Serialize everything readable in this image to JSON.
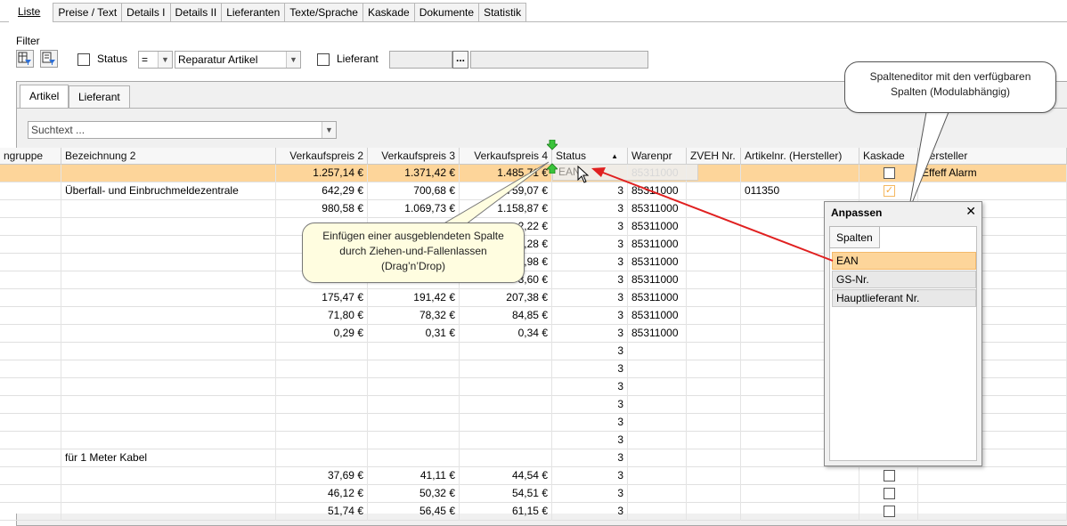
{
  "top_tabs": [
    "Liste",
    "Preise / Text",
    "Details I",
    "Details II",
    "Lieferanten",
    "Texte/Sprache",
    "Kaskade",
    "Dokumente",
    "Statistik"
  ],
  "filter": {
    "label": "Filter",
    "status_label": "Status",
    "operator": "=",
    "status_value": "Reparatur Artikel",
    "lieferant_label": "Lieferant",
    "lieferant_button": "..."
  },
  "inner_tabs": [
    "Artikel",
    "Lieferant"
  ],
  "search_placeholder": "Suchtext ...",
  "columns": [
    "ngruppe",
    "Bezeichnung 2",
    "Verkaufspreis 2",
    "Verkaufspreis 3",
    "Verkaufspreis 4",
    "Status",
    "Warenpr",
    "ZVEH Nr.",
    "Artikelnr. (Hersteller)",
    "Kaskade",
    "Hersteller"
  ],
  "sort_icon": "sort-ascending-icon",
  "rows": [
    {
      "bez": "",
      "vk2": "1.257,14 €",
      "vk3": "1.371,42 €",
      "vk4": "1.485,71 €",
      "status": "",
      "waren": "85311000",
      "zveh": "",
      "artnr": "",
      "kaskade": "unchecked",
      "hersteller": "Effeff Alarm"
    },
    {
      "bez": "Überfall- und Einbruchmeldezentrale",
      "vk2": "642,29 €",
      "vk3": "700,68 €",
      "vk4": "759,07 €",
      "status": "3",
      "waren": "85311000",
      "zveh": "",
      "artnr": "011350",
      "kaskade": "checked",
      "hersteller": ""
    },
    {
      "bez": "",
      "vk2": "980,58 €",
      "vk3": "1.069,73 €",
      "vk4": "1.158,87 €",
      "status": "3",
      "waren": "85311000",
      "zveh": "",
      "artnr": "",
      "kaskade": "",
      "hersteller": ""
    },
    {
      "bez": "",
      "vk2": "",
      "vk3": "",
      "vk4": "2,22 €",
      "status": "3",
      "waren": "85311000",
      "zveh": "",
      "artnr": "",
      "kaskade": "",
      "hersteller": ""
    },
    {
      "bez": "",
      "vk2": "",
      "vk3": "",
      "vk4": "8,28 €",
      "status": "3",
      "waren": "85311000",
      "zveh": "",
      "artnr": "",
      "kaskade": "",
      "hersteller": ""
    },
    {
      "bez": "",
      "vk2": "",
      "vk3": "",
      "vk4": "5,98 €",
      "status": "3",
      "waren": "85311000",
      "zveh": "",
      "artnr": "",
      "kaskade": "",
      "hersteller": ""
    },
    {
      "bez": "",
      "vk2": "",
      "vk3": "",
      "vk4": "3,60 €",
      "status": "3",
      "waren": "85311000",
      "zveh": "",
      "artnr": "",
      "kaskade": "",
      "hersteller": ""
    },
    {
      "bez": "",
      "vk2": "175,47 €",
      "vk3": "191,42 €",
      "vk4": "207,38 €",
      "status": "3",
      "waren": "85311000",
      "zveh": "",
      "artnr": "",
      "kaskade": "",
      "hersteller": ""
    },
    {
      "bez": "",
      "vk2": "71,80 €",
      "vk3": "78,32 €",
      "vk4": "84,85 €",
      "status": "3",
      "waren": "85311000",
      "zveh": "",
      "artnr": "",
      "kaskade": "",
      "hersteller": ""
    },
    {
      "bez": "",
      "vk2": "0,29 €",
      "vk3": "0,31 €",
      "vk4": "0,34 €",
      "status": "3",
      "waren": "85311000",
      "zveh": "",
      "artnr": "",
      "kaskade": "",
      "hersteller": ""
    },
    {
      "bez": "",
      "vk2": "",
      "vk3": "",
      "vk4": "",
      "status": "3",
      "waren": "",
      "zveh": "",
      "artnr": "",
      "kaskade": "",
      "hersteller": ""
    },
    {
      "bez": "",
      "vk2": "",
      "vk3": "",
      "vk4": "",
      "status": "3",
      "waren": "",
      "zveh": "",
      "artnr": "",
      "kaskade": "",
      "hersteller": ""
    },
    {
      "bez": "",
      "vk2": "",
      "vk3": "",
      "vk4": "",
      "status": "3",
      "waren": "",
      "zveh": "",
      "artnr": "",
      "kaskade": "",
      "hersteller": ""
    },
    {
      "bez": "",
      "vk2": "",
      "vk3": "",
      "vk4": "",
      "status": "3",
      "waren": "",
      "zveh": "",
      "artnr": "",
      "kaskade": "",
      "hersteller": ""
    },
    {
      "bez": "",
      "vk2": "",
      "vk3": "",
      "vk4": "",
      "status": "3",
      "waren": "",
      "zveh": "",
      "artnr": "",
      "kaskade": "",
      "hersteller": ""
    },
    {
      "bez": "",
      "vk2": "",
      "vk3": "",
      "vk4": "",
      "status": "3",
      "waren": "",
      "zveh": "",
      "artnr": "",
      "kaskade": "",
      "hersteller": ""
    },
    {
      "bez": "für 1 Meter Kabel",
      "vk2": "",
      "vk3": "",
      "vk4": "",
      "status": "3",
      "waren": "",
      "zveh": "",
      "artnr": "",
      "kaskade": "",
      "hersteller": ""
    },
    {
      "bez": "",
      "vk2": "37,69 €",
      "vk3": "41,11 €",
      "vk4": "44,54 €",
      "status": "3",
      "waren": "",
      "zveh": "",
      "artnr": "",
      "kaskade": "unchecked",
      "hersteller": ""
    },
    {
      "bez": "",
      "vk2": "46,12 €",
      "vk3": "50,32 €",
      "vk4": "54,51 €",
      "status": "3",
      "waren": "",
      "zveh": "",
      "artnr": "",
      "kaskade": "unchecked",
      "hersteller": ""
    },
    {
      "bez": "",
      "vk2": "51,74 €",
      "vk3": "56,45 €",
      "vk4": "61,15 €",
      "status": "3",
      "waren": "",
      "zveh": "",
      "artnr": "",
      "kaskade": "unchecked",
      "hersteller": ""
    }
  ],
  "drag_ghost": "EAN",
  "callout_drag": [
    "Einfügen einer ausgeblendeten Spalte",
    "durch Ziehen-und-Fallenlassen",
    "(Drag’n’Drop)"
  ],
  "callout_editor": [
    "Spalteneditor mit den verfügbaren",
    "Spalten (Modulabhängig)"
  ],
  "popup": {
    "title": "Anpassen",
    "close": "✕",
    "tab": "Spalten",
    "items": [
      "EAN",
      "GS-Nr.",
      "Hauptlieferant Nr."
    ]
  },
  "colors": {
    "selection": "#fdd59a",
    "arrow": "#e02020",
    "callout": "#fffde0"
  }
}
